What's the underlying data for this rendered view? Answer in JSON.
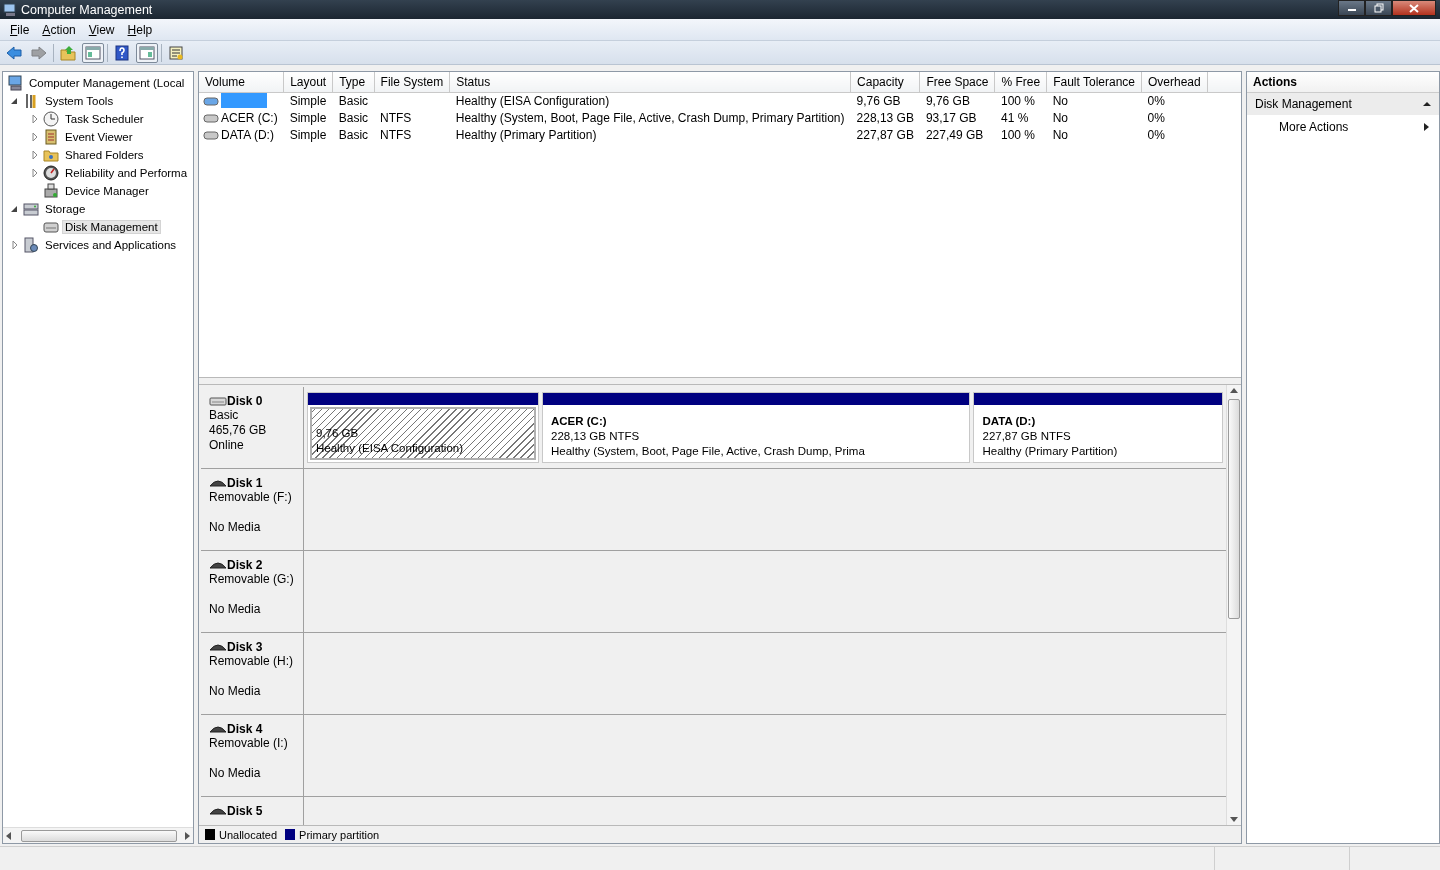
{
  "window": {
    "title": "Computer Management"
  },
  "menu": [
    {
      "label": "File"
    },
    {
      "label": "Action"
    },
    {
      "label": "View"
    },
    {
      "label": "Help"
    }
  ],
  "toolbar": [
    {
      "kind": "back",
      "disabled": false
    },
    {
      "kind": "forward",
      "disabled": true
    },
    {
      "kind": "sep"
    },
    {
      "kind": "up",
      "on": false
    },
    {
      "kind": "tree-toggle",
      "on": true
    },
    {
      "kind": "sep"
    },
    {
      "kind": "help",
      "on": false
    },
    {
      "kind": "pane-toggle",
      "on": true
    },
    {
      "kind": "sep"
    },
    {
      "kind": "properties",
      "on": false
    }
  ],
  "tree": [
    {
      "label": "Computer Management (Local",
      "kind": "computer",
      "selected": false,
      "children": [
        {
          "label": "System Tools",
          "kind": "tools",
          "expanded": true,
          "selected": false,
          "children": [
            {
              "label": "Task Scheduler",
              "kind": "clock",
              "expanded": false,
              "selected": false
            },
            {
              "label": "Event Viewer",
              "kind": "log",
              "expanded": false,
              "selected": false
            },
            {
              "label": "Shared Folders",
              "kind": "folder",
              "expanded": false,
              "selected": false
            },
            {
              "label": "Reliability and Performa",
              "kind": "gauge",
              "expanded": false,
              "selected": false
            },
            {
              "label": "Device Manager",
              "kind": "device",
              "selected": false
            }
          ]
        },
        {
          "label": "Storage",
          "kind": "storage",
          "expanded": true,
          "selected": false,
          "children": [
            {
              "label": "Disk Management",
              "kind": "disk",
              "selected": true
            }
          ]
        },
        {
          "label": "Services and Applications",
          "kind": "services",
          "expanded": false,
          "selected": false
        }
      ]
    }
  ],
  "volume_table": {
    "columns": [
      "Volume",
      "Layout",
      "Type",
      "File System",
      "Status",
      "Capacity",
      "Free Space",
      "% Free",
      "Fault Tolerance",
      "Overhead"
    ],
    "rows": [
      {
        "selected": true,
        "cells": [
          null,
          "Simple",
          "Basic",
          null,
          "Healthy (EISA Configuration)",
          "9,76 GB",
          "9,76 GB",
          "100 %",
          "No",
          "0%"
        ]
      },
      {
        "selected": false,
        "cells": [
          "ACER (C:)",
          "Simple",
          "Basic",
          "NTFS",
          "Healthy (System, Boot, Page File, Active, Crash Dump, Primary Partition)",
          "228,13 GB",
          "93,17 GB",
          "41 %",
          "No",
          "0%"
        ]
      },
      {
        "selected": false,
        "cells": [
          "DATA (D:)",
          "Simple",
          "Basic",
          "NTFS",
          "Healthy (Primary Partition)",
          "227,87 GB",
          "227,49 GB",
          "100 %",
          "No",
          "0%"
        ]
      }
    ]
  },
  "disks": [
    {
      "kind": "basic",
      "name": "Disk 0",
      "type": "Basic",
      "size": "465,76 GB",
      "status": "Online",
      "partitions": [
        {
          "selected": true,
          "size": "9,76 GB",
          "status": "Healthy (EISA Configuration)"
        },
        {
          "selected": false,
          "name": "ACER  (C:)",
          "size": "228,13 GB NTFS",
          "status": "Healthy (System, Boot, Page File, Active, Crash Dump, Prima"
        },
        {
          "selected": false,
          "name": "DATA  (D:)",
          "size": "227,87 GB NTFS",
          "status": "Healthy (Primary Partition)"
        }
      ]
    },
    {
      "kind": "removable",
      "name": "Disk 1",
      "type": "Removable (F:)",
      "status": "No Media"
    },
    {
      "kind": "removable",
      "name": "Disk 2",
      "type": "Removable (G:)",
      "status": "No Media"
    },
    {
      "kind": "removable",
      "name": "Disk 3",
      "type": "Removable (H:)",
      "status": "No Media"
    },
    {
      "kind": "removable",
      "name": "Disk 4",
      "type": "Removable (I:)",
      "status": "No Media"
    },
    {
      "kind": "removable",
      "name": "Disk 5"
    }
  ],
  "legend": [
    {
      "label": "Unallocated",
      "color": "#000000"
    },
    {
      "label": "Primary partition",
      "color": "#000080"
    }
  ],
  "actions": {
    "title": "Actions",
    "sections": [
      {
        "label": "Disk Management",
        "expanded": true,
        "items": [
          {
            "label": "More Actions"
          }
        ]
      }
    ]
  }
}
